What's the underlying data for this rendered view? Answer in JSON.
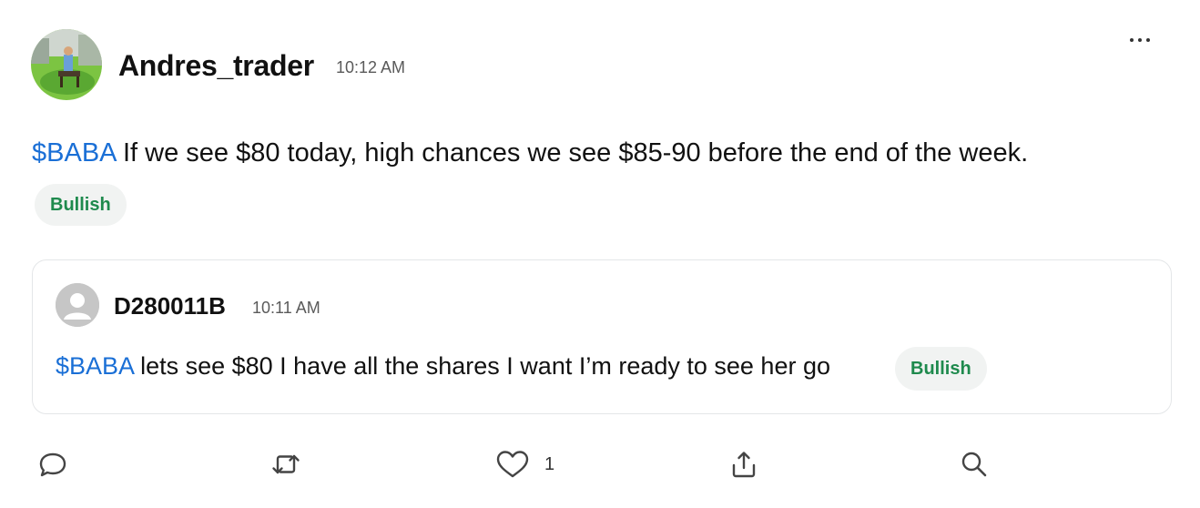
{
  "post": {
    "author": {
      "username": "Andres_trader",
      "timestamp": "10:12 AM"
    },
    "body": {
      "cashtag": "$BABA",
      "text": " If we see $80 today, high chances we see $85-90 before the end of the week."
    },
    "sentiment": "Bullish",
    "quoted_post": {
      "author": "D280011B",
      "timestamp": "10:11 AM",
      "cashtag": "$BABA",
      "text": " lets see $80 I have all the shares I want I’m ready to see her go",
      "sentiment": "Bullish"
    },
    "actions": {
      "like_count": "1"
    }
  },
  "icons": {
    "more": "more-horizontal-icon",
    "comment": "comment-bubble-icon",
    "reshare": "reshare-arrows-icon",
    "like": "heart-icon",
    "share": "share-upload-icon",
    "search": "magnifier-icon"
  },
  "colors": {
    "cashtag": "#1a6fd6",
    "bullish": "#1e8a4d",
    "badge_bg": "#f1f3f2",
    "timestamp": "#5a5a5a",
    "card_border": "#e4e6e8"
  }
}
